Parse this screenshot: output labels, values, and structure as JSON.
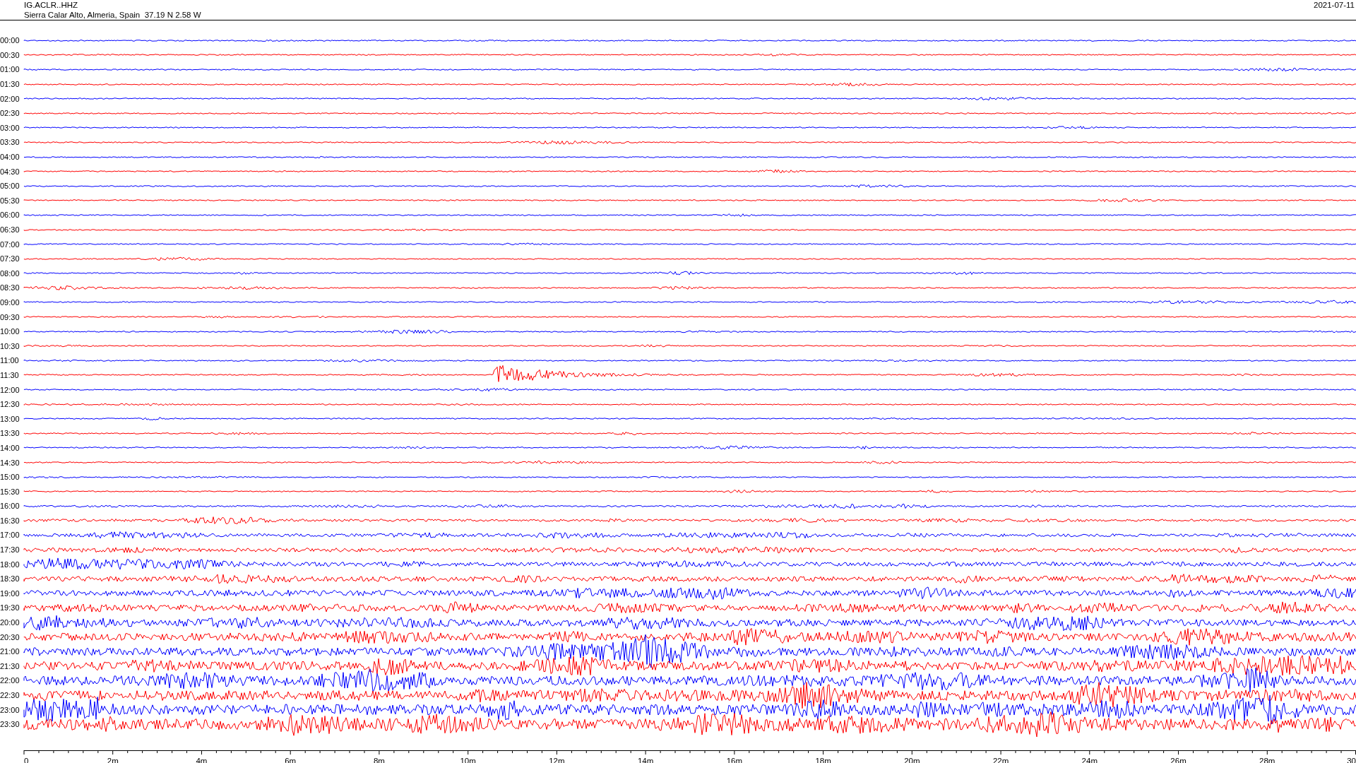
{
  "header": {
    "station": "IG.ACLR..HHZ",
    "location": "Sierra Calar Alto, Almeria, Spain  37.19 N 2.58 W",
    "date": "2021-07-11"
  },
  "traces": [
    {
      "label": "00:00",
      "color": "#0000ff"
    },
    {
      "label": "00:30",
      "color": "#ff0000"
    },
    {
      "label": "01:00",
      "color": "#0000ff"
    },
    {
      "label": "01:30",
      "color": "#ff0000"
    },
    {
      "label": "02:00",
      "color": "#0000ff"
    },
    {
      "label": "02:30",
      "color": "#ff0000"
    },
    {
      "label": "03:00",
      "color": "#0000ff"
    },
    {
      "label": "03:30",
      "color": "#ff0000"
    },
    {
      "label": "04:00",
      "color": "#0000ff"
    },
    {
      "label": "04:30",
      "color": "#ff0000"
    },
    {
      "label": "05:00",
      "color": "#0000ff"
    },
    {
      "label": "05:30",
      "color": "#ff0000"
    },
    {
      "label": "06:00",
      "color": "#0000ff"
    },
    {
      "label": "06:30",
      "color": "#ff0000"
    },
    {
      "label": "07:00",
      "color": "#0000ff"
    },
    {
      "label": "07:30",
      "color": "#ff0000"
    },
    {
      "label": "08:00",
      "color": "#0000ff"
    },
    {
      "label": "08:30",
      "color": "#ff0000"
    },
    {
      "label": "09:00",
      "color": "#0000ff"
    },
    {
      "label": "09:30",
      "color": "#ff0000"
    },
    {
      "label": "10:00",
      "color": "#0000ff"
    },
    {
      "label": "10:30",
      "color": "#ff0000"
    },
    {
      "label": "11:00",
      "color": "#0000ff"
    },
    {
      "label": "11:30",
      "color": "#ff0000"
    },
    {
      "label": "12:00",
      "color": "#0000ff"
    },
    {
      "label": "12:30",
      "color": "#ff0000"
    },
    {
      "label": "13:00",
      "color": "#0000ff"
    },
    {
      "label": "13:30",
      "color": "#ff0000"
    },
    {
      "label": "14:00",
      "color": "#0000ff"
    },
    {
      "label": "14:30",
      "color": "#ff0000"
    },
    {
      "label": "15:00",
      "color": "#0000ff"
    },
    {
      "label": "15:30",
      "color": "#ff0000"
    },
    {
      "label": "16:00",
      "color": "#0000ff"
    },
    {
      "label": "16:30",
      "color": "#ff0000"
    },
    {
      "label": "17:00",
      "color": "#0000ff"
    },
    {
      "label": "17:30",
      "color": "#ff0000"
    },
    {
      "label": "18:00",
      "color": "#0000ff"
    },
    {
      "label": "18:30",
      "color": "#ff0000"
    },
    {
      "label": "19:00",
      "color": "#0000ff"
    },
    {
      "label": "19:30",
      "color": "#ff0000"
    },
    {
      "label": "20:00",
      "color": "#0000ff"
    },
    {
      "label": "20:30",
      "color": "#ff0000"
    },
    {
      "label": "21:00",
      "color": "#0000ff"
    },
    {
      "label": "21:30",
      "color": "#ff0000"
    },
    {
      "label": "22:00",
      "color": "#0000ff"
    },
    {
      "label": "22:30",
      "color": "#ff0000"
    },
    {
      "label": "23:00",
      "color": "#0000ff"
    },
    {
      "label": "23:30",
      "color": "#ff0000"
    }
  ],
  "time_axis": {
    "labels": [
      "0",
      "2m",
      "4m",
      "6m",
      "8m",
      "10m",
      "12m",
      "14m",
      "16m",
      "18m",
      "20m",
      "22m",
      "24m",
      "26m",
      "28m",
      "30"
    ]
  }
}
